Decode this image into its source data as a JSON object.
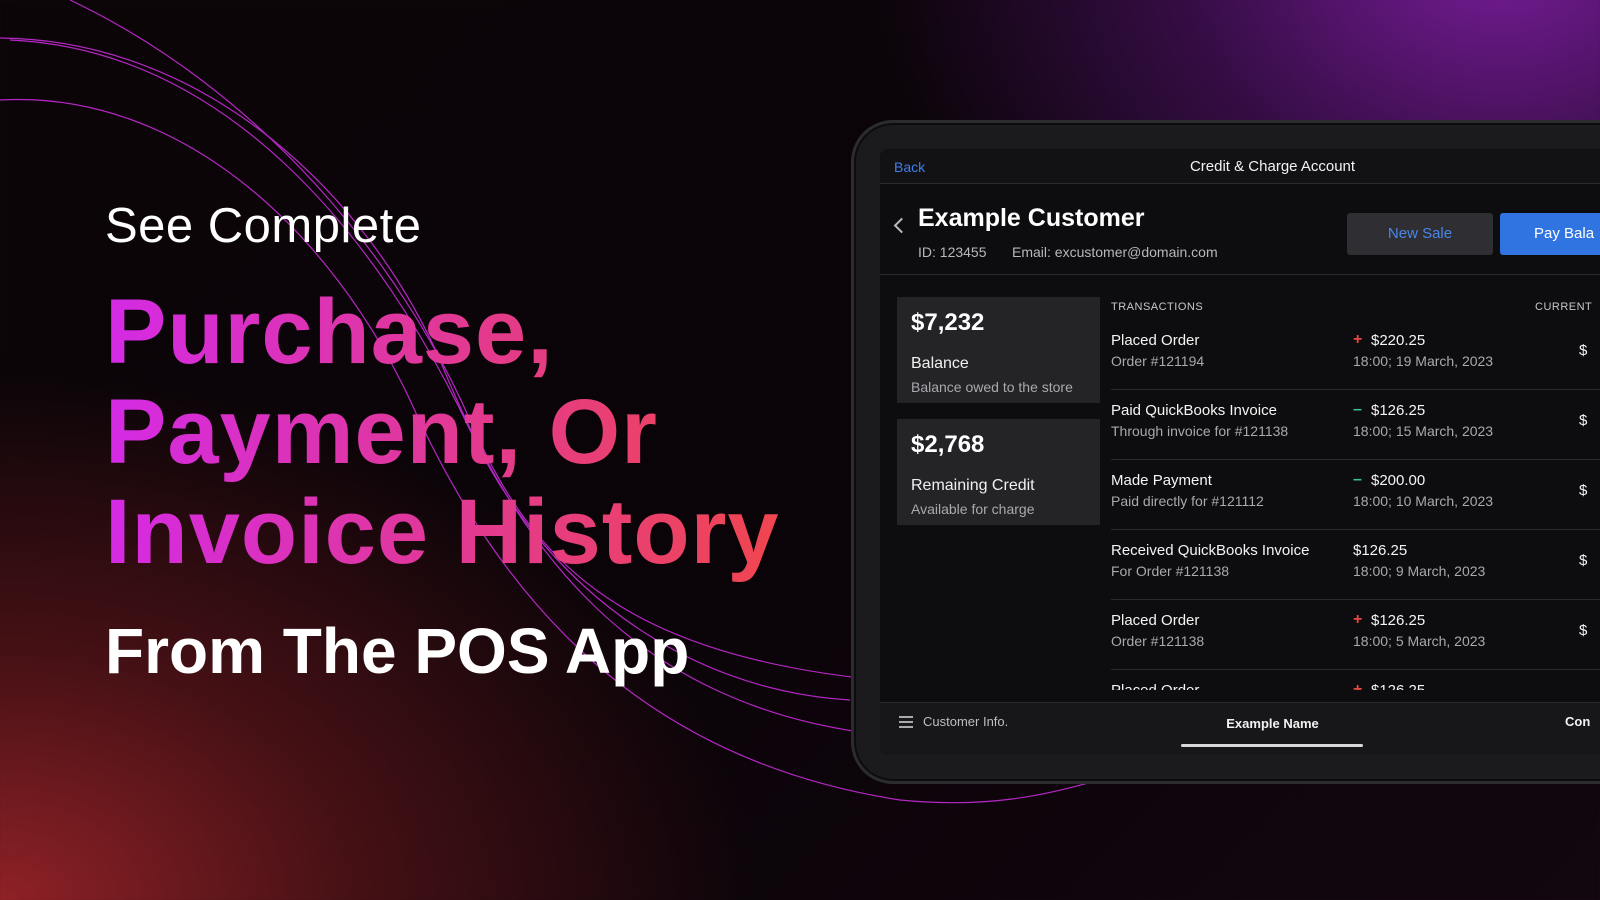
{
  "hero": {
    "pre": "See Complete",
    "lines": [
      "Purchase,",
      "Payment, Or",
      "Invoice History"
    ],
    "post": "From The POS App"
  },
  "app": {
    "navbar": {
      "back": "Back",
      "title": "Credit & Charge Account"
    },
    "customer": {
      "name": "Example Customer",
      "id": "ID: 123455",
      "email": "Email: excustomer@domain.com",
      "new_sale": "New Sale",
      "pay_balance": "Pay Bala"
    },
    "cards": [
      {
        "amount": "$7,232",
        "label": "Balance",
        "sub": "Balance owed to the store"
      },
      {
        "amount": "$2,768",
        "label": "Remaining Credit",
        "sub": "Available for charge"
      }
    ],
    "transactions_header": "TRANSACTIONS",
    "current_header": "CURRENT",
    "transactions": [
      {
        "title": "Placed Order",
        "sub": "Order #121194",
        "sign": "+",
        "amount": "$220.25",
        "date": "18:00; 19 March, 2023",
        "current": "$"
      },
      {
        "title": "Paid QuickBooks Invoice",
        "sub": "Through invoice for #121138",
        "sign": "–",
        "amount": "$126.25",
        "date": "18:00; 15 March, 2023",
        "current": "$"
      },
      {
        "title": "Made Payment",
        "sub": "Paid directly for #121112",
        "sign": "–",
        "amount": "$200.00",
        "date": "18:00; 10 March, 2023",
        "current": "$"
      },
      {
        "title": "Received QuickBooks Invoice",
        "sub": "For Order #121138",
        "sign": "",
        "amount": "$126.25",
        "date": "18:00; 9 March, 2023",
        "current": "$"
      },
      {
        "title": "Placed Order",
        "sub": "Order #121138",
        "sign": "+",
        "amount": "$126.25",
        "date": "18:00; 5 March, 2023",
        "current": "$"
      },
      {
        "title": "Placed Order",
        "sub": "",
        "sign": "+",
        "amount": "$126.25",
        "date": "",
        "current": ""
      }
    ],
    "bottom": {
      "info": "Customer Info.",
      "name": "Example Name",
      "right": "Con"
    }
  },
  "colors": {
    "accent_blue": "#2f74e0",
    "plus_red": "#e8463f",
    "minus_green": "#34c38a",
    "gradient_start": "#d42ae6",
    "gradient_end": "#f0464f"
  }
}
